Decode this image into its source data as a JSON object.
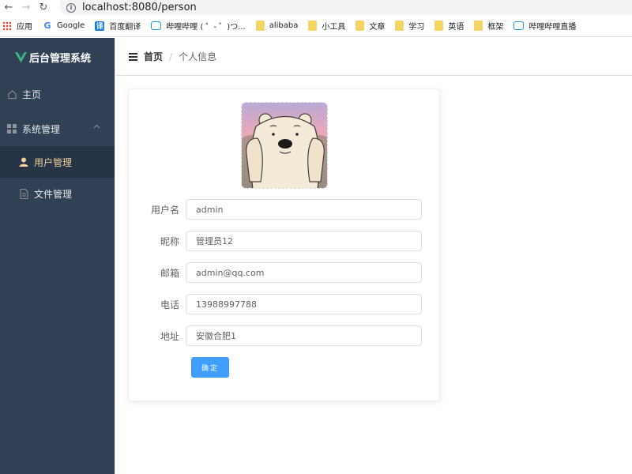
{
  "browser": {
    "url": "localhost:8080/person",
    "bookmarks": [
      {
        "label": "应用",
        "icon": "apps-icon"
      },
      {
        "label": "Google",
        "icon": "google-icon"
      },
      {
        "label": "百度翻译",
        "icon": "translate-icon"
      },
      {
        "label": "哔哩哔哩 ( ゜- ゜)つ...",
        "icon": "bilibili-icon"
      },
      {
        "label": "alibaba",
        "icon": "folder-icon"
      },
      {
        "label": "小工具",
        "icon": "folder-icon"
      },
      {
        "label": "文章",
        "icon": "folder-icon"
      },
      {
        "label": "学习",
        "icon": "folder-icon"
      },
      {
        "label": "英语",
        "icon": "folder-icon"
      },
      {
        "label": "框架",
        "icon": "folder-icon"
      },
      {
        "label": "哔哩哔哩直播",
        "icon": "bilibili-icon"
      }
    ]
  },
  "sidebar": {
    "title": "后台管理系统",
    "items": {
      "home": "主页",
      "system": "系统管理",
      "users": "用户管理",
      "files": "文件管理"
    }
  },
  "header": {
    "breadcrumb_home": "首页",
    "breadcrumb_separator": "/",
    "breadcrumb_current": "个人信息"
  },
  "form": {
    "username": {
      "label": "用户名",
      "value": "admin"
    },
    "nickname": {
      "label": "昵称",
      "value": "管理员12"
    },
    "email": {
      "label": "邮箱",
      "value": "admin@qq.com"
    },
    "phone": {
      "label": "电话",
      "value": "13988997788"
    },
    "address": {
      "label": "地址",
      "value": "安徽合肥1"
    },
    "submit_label": "确定"
  },
  "colors": {
    "sidebar_bg": "#304156",
    "active_text": "#f3d19e",
    "primary": "#409eff"
  }
}
